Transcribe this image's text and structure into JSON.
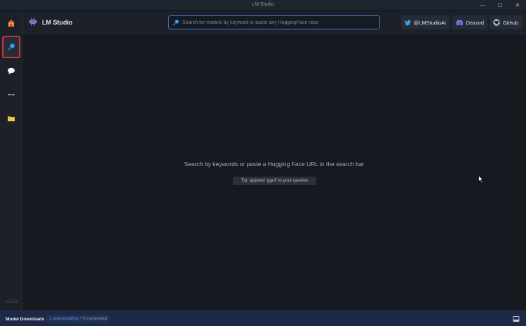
{
  "window": {
    "title": "LM Studio",
    "minimize_glyph": "—",
    "maximize_glyph": "☐",
    "close_glyph": "✕"
  },
  "sidebar": {
    "items": [
      {
        "name": "home",
        "icon": "home-icon"
      },
      {
        "name": "search",
        "icon": "magnifier-icon",
        "selected": true
      },
      {
        "name": "chat",
        "icon": "chat-bubble-icon"
      },
      {
        "name": "local-server",
        "icon": "arrows-icon"
      },
      {
        "name": "my-models",
        "icon": "folder-icon"
      }
    ],
    "version": "v0.2.8"
  },
  "header": {
    "app_name": "LM Studio",
    "search_placeholder": "Search for models by keyword or paste any HuggingFace repo",
    "links": [
      {
        "label": "@LMStudioAI",
        "icon": "twitter-icon"
      },
      {
        "label": "Discord",
        "icon": "discord-icon"
      },
      {
        "label": "Github",
        "icon": "github-icon"
      }
    ]
  },
  "main": {
    "empty_message": "Search by keywords or paste a Hugging Face URL in the search bar",
    "tip": "Tip: append 'gguf' to your queries"
  },
  "downloads": {
    "title": "Model Downloads",
    "downloading": "1 downloading",
    "separator": "•",
    "completed": "0 completed"
  },
  "colors": {
    "accent": "#4a7bd9",
    "selected_outline": "#d2323a",
    "bottom_bar": "#1c2a45",
    "downloading_text": "#4f8ef0"
  }
}
